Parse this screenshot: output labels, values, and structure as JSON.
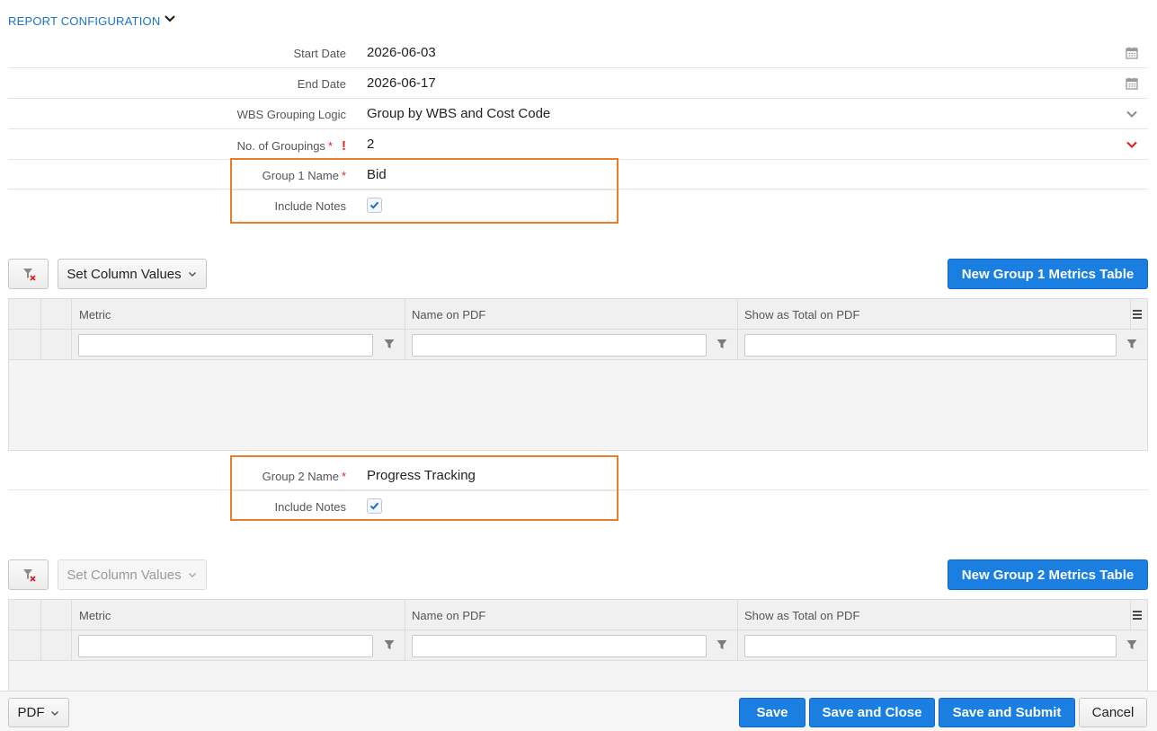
{
  "section": {
    "title": "REPORT CONFIGURATION"
  },
  "fields": {
    "start_date": {
      "label": "Start Date",
      "value": "2026-06-03"
    },
    "end_date": {
      "label": "End Date",
      "value": "2026-06-17"
    },
    "wbs_grouping": {
      "label": "WBS Grouping Logic",
      "value": "Group by WBS and Cost Code"
    },
    "groupings": {
      "label": "No. of Groupings",
      "value": "2",
      "required_mark": "*",
      "warning_mark": "!"
    }
  },
  "group1": {
    "name_label": "Group 1 Name",
    "name_value": "Bid",
    "required_mark": "*",
    "notes_label": "Include Notes",
    "notes_checked": true,
    "set_column_values": "Set Column Values",
    "new_table_button": "New Group 1 Metrics Table",
    "columns": [
      "Metric",
      "Name on PDF",
      "Show as Total on PDF"
    ]
  },
  "group2": {
    "name_label": "Group 2 Name",
    "name_value": "Progress Tracking",
    "required_mark": "*",
    "notes_label": "Include Notes",
    "notes_checked": true,
    "set_column_values": "Set Column Values",
    "new_table_button": "New Group 2 Metrics Table",
    "columns": [
      "Metric",
      "Name on PDF",
      "Show as Total on PDF"
    ]
  },
  "footer": {
    "pdf": "PDF",
    "save": "Save",
    "save_close": "Save and Close",
    "save_submit": "Save and Submit",
    "cancel": "Cancel"
  },
  "colors": {
    "accent": "#1a7fe0",
    "highlight": "#e87d2c",
    "required": "#e02424"
  },
  "icons": [
    "chevron-down-icon",
    "calendar-icon",
    "clear-filter-icon",
    "filter-icon",
    "menu-icon",
    "checkmark-icon"
  ]
}
